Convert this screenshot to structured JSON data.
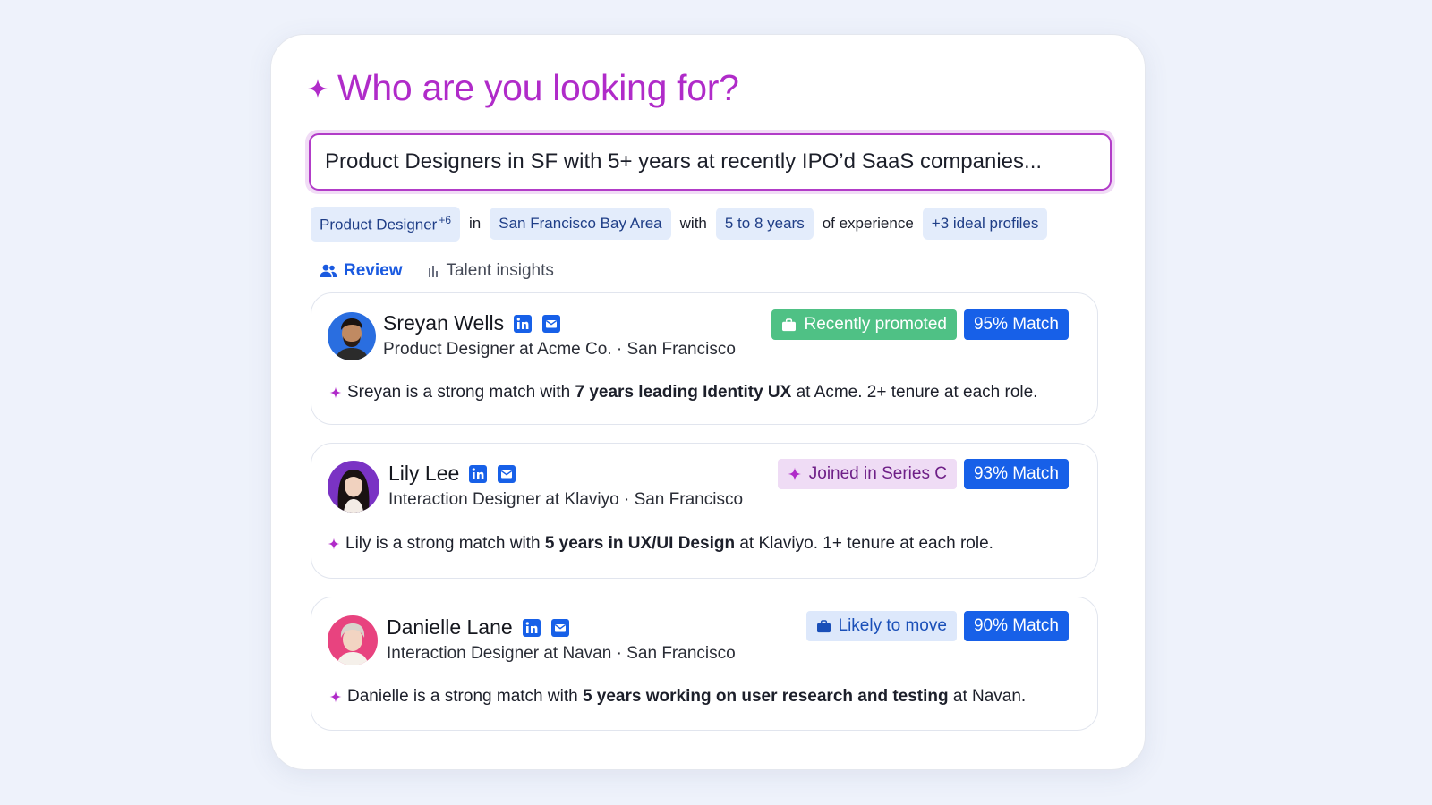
{
  "header": {
    "title": "Who are you looking for?"
  },
  "search": {
    "value": "Product Designers in SF with 5+ years at recently IPO’d SaaS companies..."
  },
  "filters": {
    "role": "Product Designer",
    "role_more": "+6",
    "in": "in",
    "location": "San Francisco Bay Area",
    "with": "with",
    "experience": "5 to 8 years",
    "of_experience": "of experience",
    "ideal_profiles": "+3 ideal profiles"
  },
  "tabs": {
    "review": "Review",
    "talent_insights": "Talent insights"
  },
  "candidates": [
    {
      "name": "Sreyan Wells",
      "title": "Product Designer at Acme Co. · San Francisco",
      "badge": "Recently promoted",
      "match": "95% Match",
      "summary_pre": "Sreyan is a strong match with ",
      "summary_bold": "7 years leading Identity UX",
      "summary_post": " at Acme. 2+ tenure at each role."
    },
    {
      "name": "Lily Lee",
      "title": "Interaction Designer at Klaviyo · San Francisco",
      "badge": "Joined in Series C",
      "match": "93% Match",
      "summary_pre": "Lily is a strong match with ",
      "summary_bold": "5 years in UX/UI Design",
      "summary_post": " at Klaviyo. 1+ tenure at each role."
    },
    {
      "name": "Danielle Lane",
      "title": "Interaction Designer at Navan · San Francisco",
      "badge": "Likely to move",
      "match": "90% Match",
      "summary_pre": "Danielle is a strong match with ",
      "summary_bold": "5 years working on user research and testing",
      "summary_post": " at Navan."
    }
  ],
  "colors": {
    "accent_purple": "#b02bc9",
    "primary_blue": "#1760e8",
    "success_green": "#4fc185",
    "chip_blue": "#e3ecfb"
  },
  "icons": [
    "sparkle-icon",
    "users-icon",
    "bar-chart-icon",
    "linkedin-icon",
    "mail-icon",
    "briefcase-icon"
  ]
}
